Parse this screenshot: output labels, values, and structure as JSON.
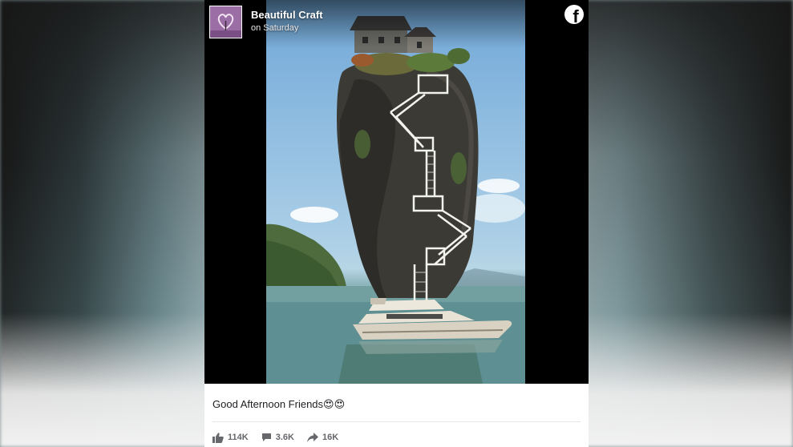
{
  "post": {
    "page_name": "Beautiful Craft",
    "timestamp": "on Saturday",
    "caption": "Good Afternoon Friends😍😍",
    "platform_icon": "facebook-logo-icon",
    "stats": {
      "likes": "114K",
      "comments": "3.6K",
      "shares": "16K"
    }
  },
  "icons": {
    "like": "thumbs-up-icon",
    "comment": "comment-icon",
    "share": "share-icon"
  },
  "colors": {
    "facebook_white": "#ffffff",
    "stat_text": "#65676b",
    "caption_text": "#1c1e21"
  }
}
